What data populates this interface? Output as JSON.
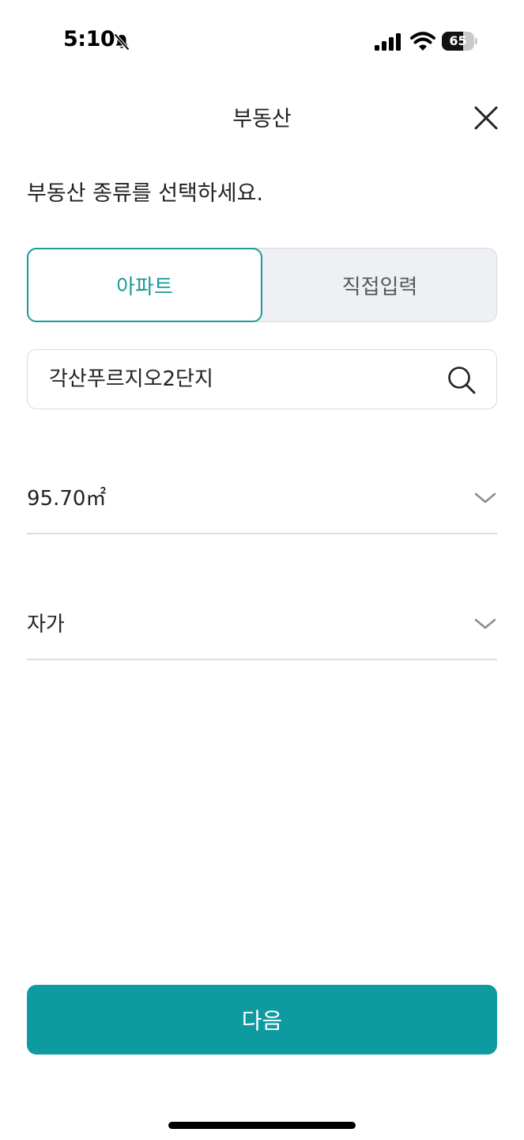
{
  "status_bar": {
    "time": "5:10",
    "battery_level": "65",
    "battery_fraction": 0.65,
    "icons": [
      "bell-slash-icon",
      "cellular-signal-icon",
      "wifi-icon",
      "battery-icon"
    ]
  },
  "header": {
    "title": "부동산",
    "close_icon": "close-icon"
  },
  "instruction": "부동산 종류를 선택하세요.",
  "property_type": {
    "options": [
      {
        "label": "아파트",
        "selected": true
      },
      {
        "label": "직접입력",
        "selected": false
      }
    ]
  },
  "search": {
    "value": "각산푸르지오2단지",
    "icon": "search-icon"
  },
  "area_select": {
    "value": "95.70㎡",
    "icon": "chevron-down-icon"
  },
  "ownership_select": {
    "value": "자가",
    "icon": "chevron-down-icon"
  },
  "next_button": {
    "label": "다음"
  },
  "colors": {
    "accent": "#1a9a9c",
    "button": "#0d9aa0",
    "segment_bg": "#eff0f4",
    "divider": "#dcdde0"
  }
}
